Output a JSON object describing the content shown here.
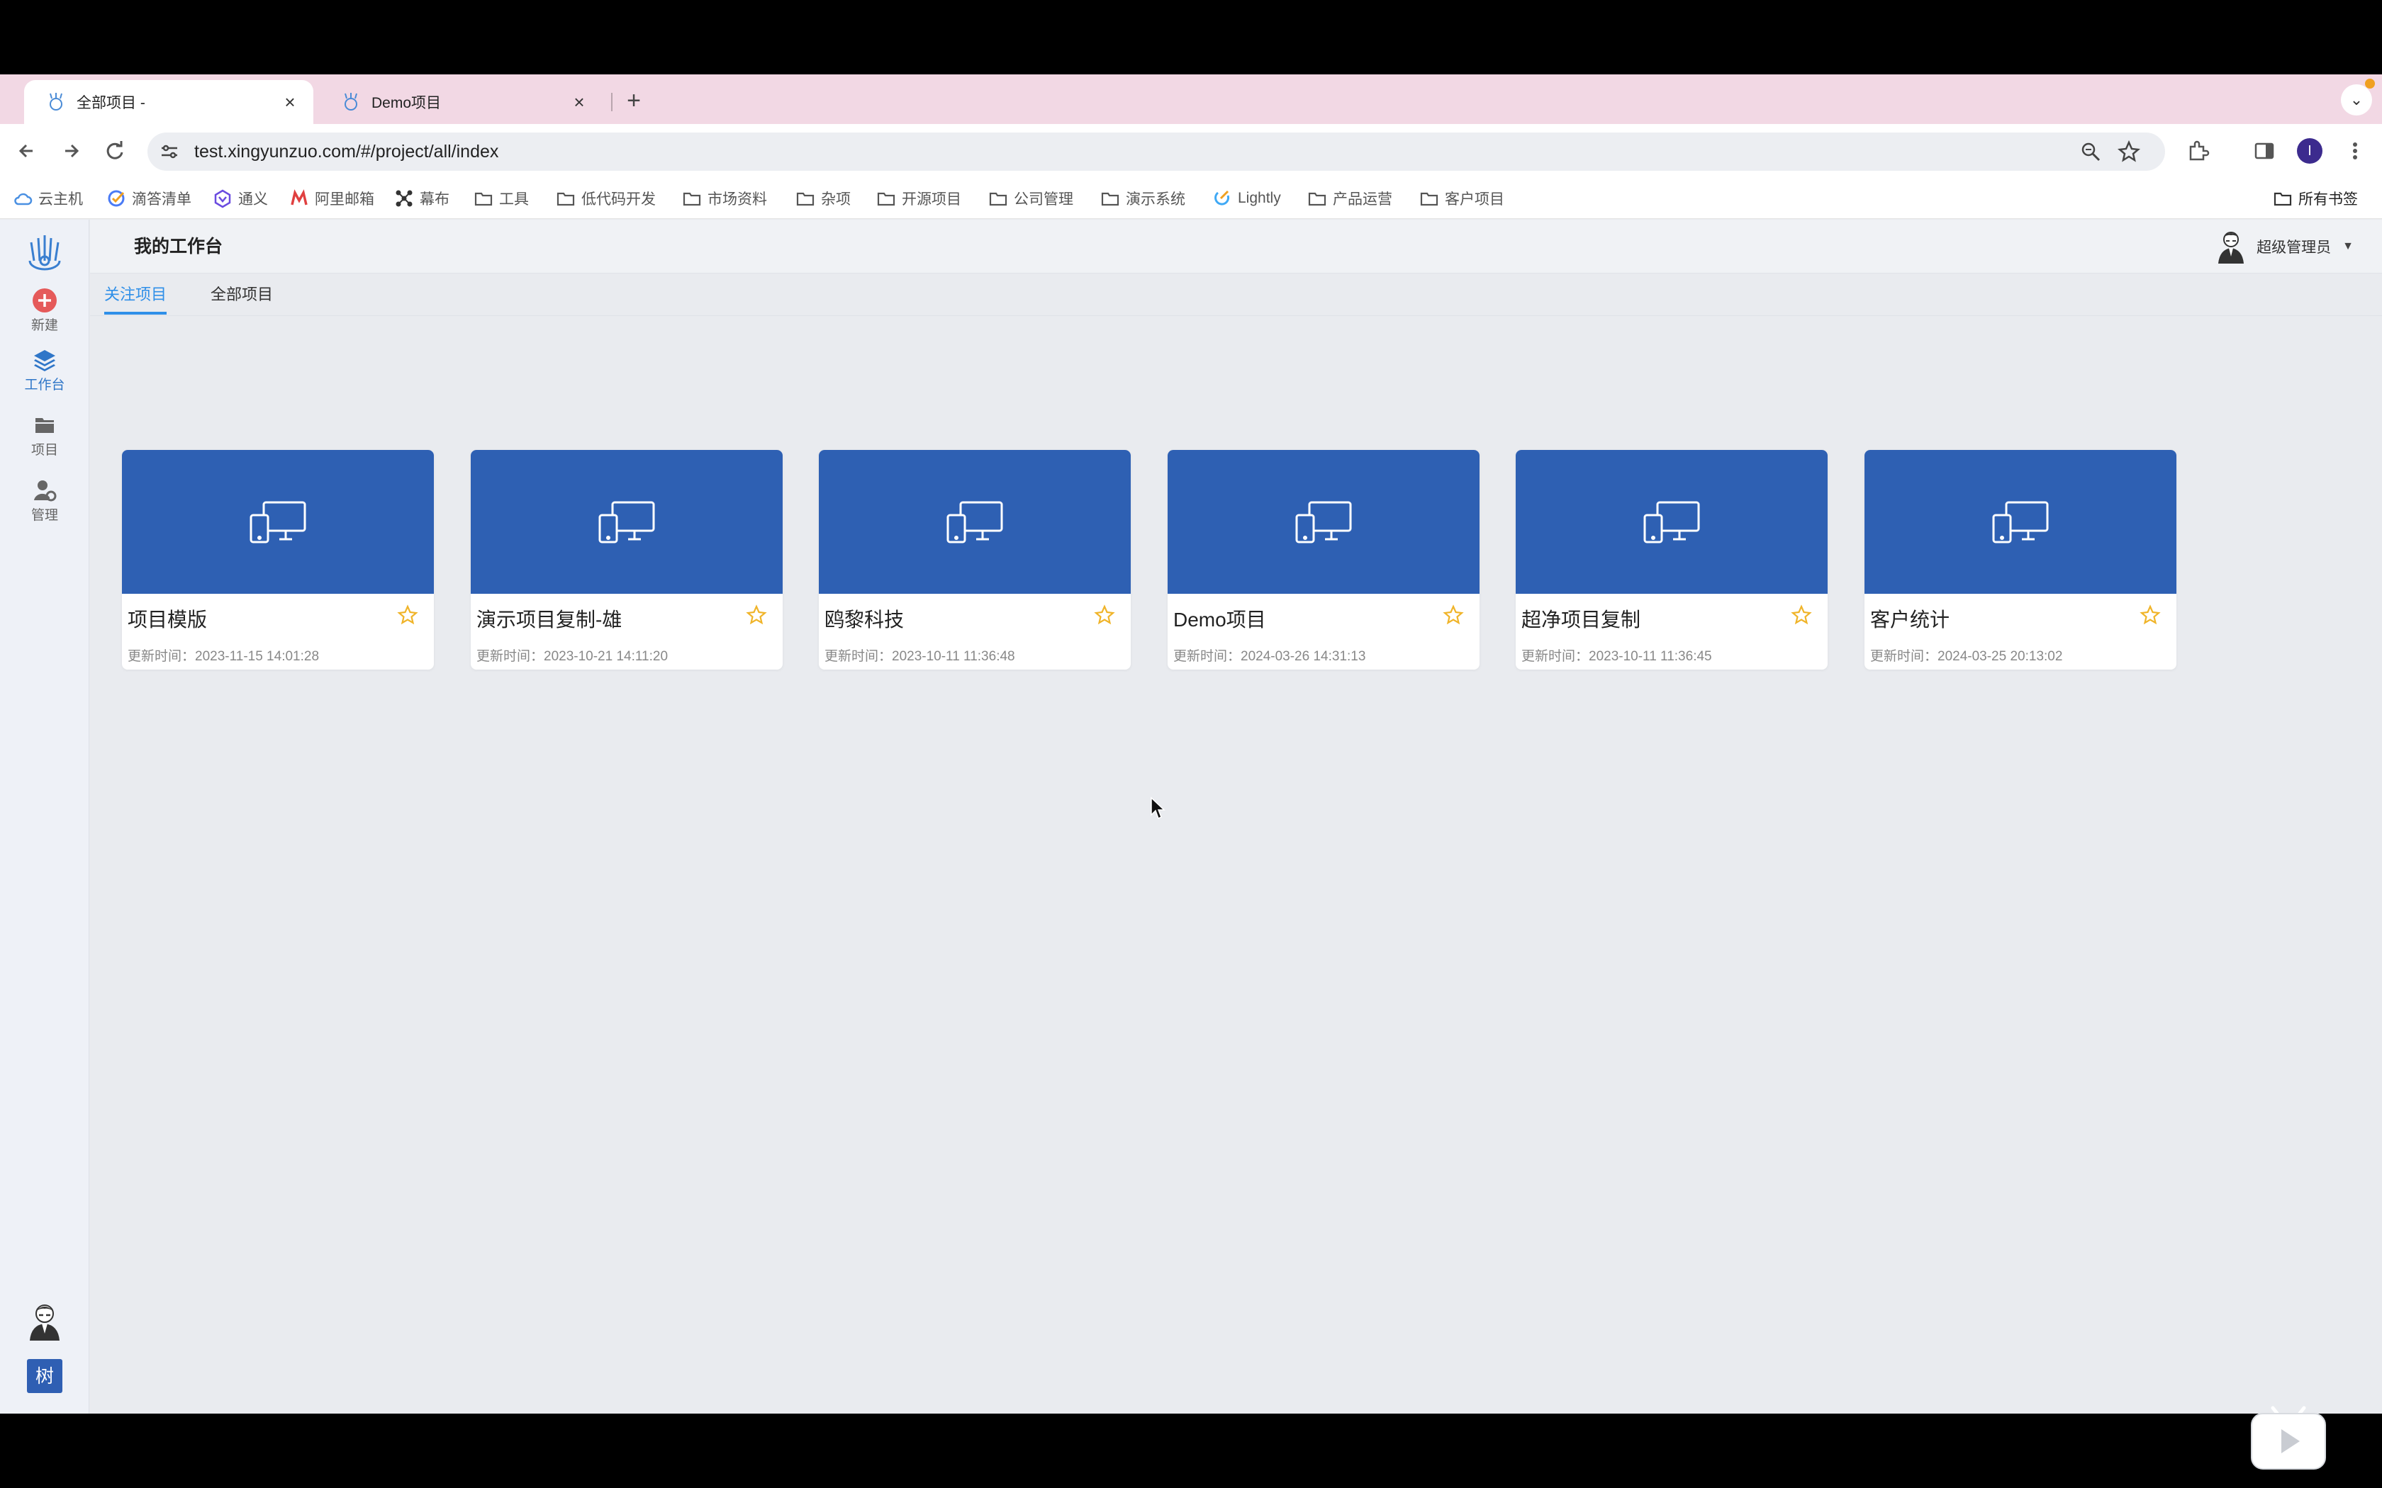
{
  "browser": {
    "tabs": [
      {
        "title": "全部项目 -",
        "close": "×"
      },
      {
        "title": "Demo项目",
        "close": "×"
      }
    ],
    "new_tab": "+",
    "tab_menu": "⌄",
    "url": "test.xingyunzuo.com/#/project/all/index",
    "profile_initial": "I"
  },
  "bookmarks": [
    {
      "label": "云主机",
      "icon": "cloud-icon"
    },
    {
      "label": "滴答清单",
      "icon": "check-circle-icon"
    },
    {
      "label": "通义",
      "icon": "tongyi-icon"
    },
    {
      "label": "阿里邮箱",
      "icon": "mail-m-icon"
    },
    {
      "label": "幕布",
      "icon": "mindmap-icon"
    },
    {
      "label": "工具",
      "icon": "folder-icon"
    },
    {
      "label": "低代码开发",
      "icon": "folder-icon"
    },
    {
      "label": "市场资料",
      "icon": "folder-icon"
    },
    {
      "label": "杂项",
      "icon": "folder-icon"
    },
    {
      "label": "开源项目",
      "icon": "folder-icon"
    },
    {
      "label": "公司管理",
      "icon": "folder-icon"
    },
    {
      "label": "演示系统",
      "icon": "folder-icon"
    },
    {
      "label": "Lightly",
      "icon": "lightly-icon"
    },
    {
      "label": "产品运营",
      "icon": "folder-icon"
    },
    {
      "label": "客户项目",
      "icon": "folder-icon"
    }
  ],
  "all_bookmarks": "所有书签",
  "sidebar": {
    "items": [
      {
        "label": "新建",
        "icon": "plus-circle-icon"
      },
      {
        "label": "工作台",
        "icon": "layers-icon"
      },
      {
        "label": "项目",
        "icon": "folder-icon"
      },
      {
        "label": "管理",
        "icon": "user-gear-icon"
      }
    ],
    "active": "工作台",
    "tree_label": "树"
  },
  "header": {
    "title": "我的工作台",
    "user_name": "超级管理员"
  },
  "page_tabs": [
    "关注项目",
    "全部项目"
  ],
  "active_tab": "关注项目",
  "projects": [
    {
      "name": "项目模版",
      "updated": "更新时间：2023-11-15 14:01:28"
    },
    {
      "name": "演示项目复制-雄",
      "updated": "更新时间：2023-10-21 14:11:20"
    },
    {
      "name": "鸥黎科技",
      "updated": "更新时间：2023-10-11 11:36:48"
    },
    {
      "name": "Demo项目",
      "updated": "更新时间：2024-03-26 14:31:13"
    },
    {
      "name": "超净项目复制",
      "updated": "更新时间：2023-10-11 11:36:45"
    },
    {
      "name": "客户统计",
      "updated": "更新时间：2024-03-25 20:13:02"
    }
  ],
  "colors": {
    "accent": "#2f8fe8",
    "card_cover": "#2e60b3",
    "star": "#f0b429",
    "new_button": "#e55a5a",
    "tab_strip": "#f2d8e4"
  }
}
